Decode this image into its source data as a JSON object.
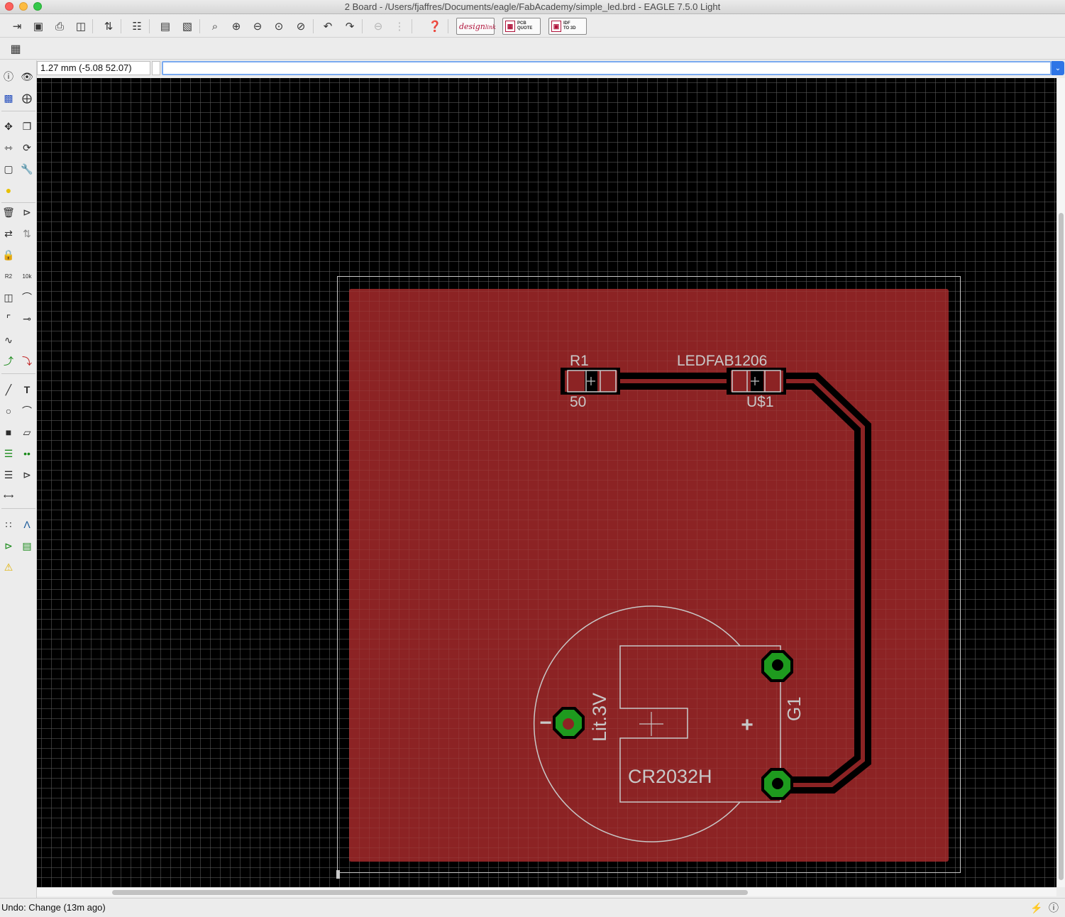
{
  "window": {
    "title": "2 Board - /Users/fjaffres/Documents/eagle/FabAcademy/simple_led.brd - EAGLE 7.5.0 Light"
  },
  "toolbar": {
    "icons": [
      "open-icon",
      "save-icon",
      "print-icon",
      "cam-processor-icon",
      "jump-icon",
      "layer-toggle-icon",
      "script-icon",
      "run-ulp-icon",
      "zoom-fit-icon",
      "zoom-in-icon",
      "zoom-out-icon",
      "zoom-redraw-icon",
      "zoom-select-icon",
      "undo-icon",
      "redo-icon",
      "stop-icon",
      "go-icon",
      "help-icon"
    ],
    "design_link": {
      "line1": "design",
      "line2": "link"
    },
    "pcb_quote": {
      "line1": "PCB",
      "line2": "QUOTE"
    },
    "idf_3d": {
      "line1": "IDF",
      "line2": "TO 3D"
    }
  },
  "command_line": {
    "coordinate": "1.27 mm (-5.08 52.07)",
    "value": ""
  },
  "board": {
    "components": [
      {
        "name": "R1",
        "value": "50"
      },
      {
        "name": "U$1",
        "value": "LEDFAB1206"
      },
      {
        "name": "G1",
        "value": "Lit.3V",
        "package": "CR2032H"
      }
    ],
    "silkscreen_symbols": {
      "minus": "−",
      "plus": "+"
    },
    "colors": {
      "background": "#000000",
      "copper_pour": "#8c2324",
      "trace": "#000000",
      "pad": "#1e9a1e",
      "silkscreen": "#c8c8c8",
      "outline": "#c8c8c8"
    }
  },
  "status": {
    "text": "Undo: Change (13m ago)"
  }
}
